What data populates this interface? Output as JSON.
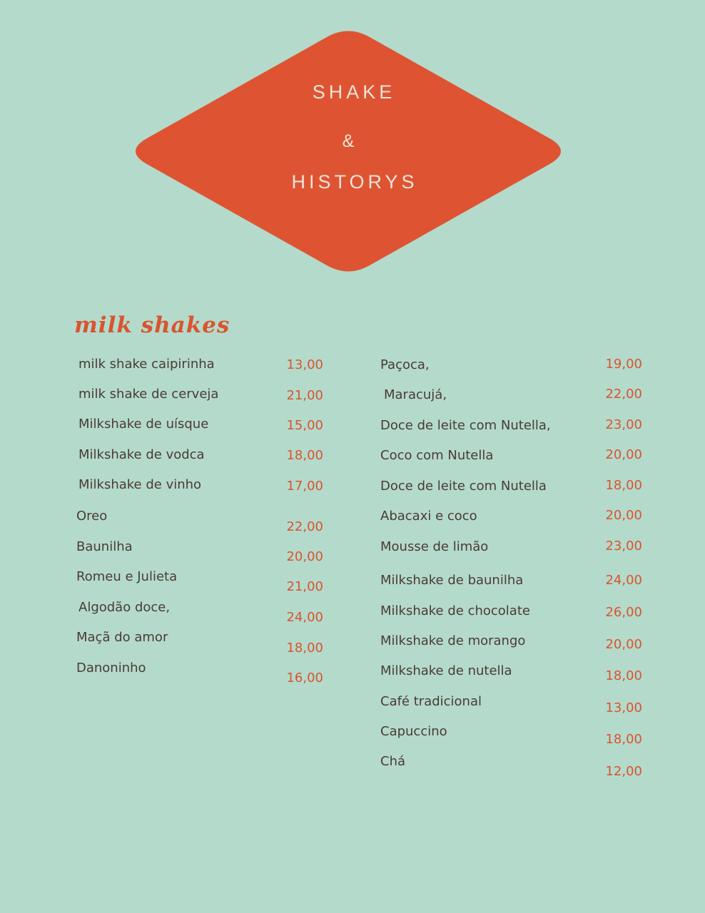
{
  "logo": {
    "line1": "SHAKE",
    "line2": "&",
    "line3": "HISTORYS",
    "fill_color": "#de5432"
  },
  "section": {
    "title": "milk shakes"
  },
  "left_items": [
    {
      "name": "milk shake caipirinha",
      "price": "13,00"
    },
    {
      "name": "milk shake de cerveja",
      "price": "21,00"
    },
    {
      "name": "Milkshake de uísque",
      "price": "15,00"
    },
    {
      "name": "Milkshake de vodca",
      "price": "18,00"
    },
    {
      "name": "Milkshake de vinho",
      "price": "17,00"
    },
    {
      "name": "Oreo",
      "price": "22,00"
    },
    {
      "name": "Baunilha",
      "price": "20,00"
    },
    {
      "name": "Romeu e Julieta",
      "price": "21,00"
    },
    {
      "name": "Algodão doce,",
      "price": "24,00"
    },
    {
      "name": "Maçã do amor",
      "price": "18,00"
    },
    {
      "name": "Danoninho",
      "price": "16,00"
    }
  ],
  "right_items": [
    {
      "name": "Paçoca,",
      "price": "19,00"
    },
    {
      "name": "Maracujá,",
      "price": "22,00"
    },
    {
      "name": "Doce de leite com Nutella,",
      "price": "23,00"
    },
    {
      "name": "Coco com Nutella",
      "price": "20,00"
    },
    {
      "name": "Doce de leite com Nutella",
      "price": "18,00"
    },
    {
      "name": "Abacaxi e coco",
      "price": "20,00"
    },
    {
      "name": "Mousse de limão",
      "price": "23,00"
    },
    {
      "name": "Milkshake de baunilha",
      "price": "24,00"
    },
    {
      "name": "Milkshake de chocolate",
      "price": "26,00"
    },
    {
      "name": "Milkshake de morango",
      "price": "20,00"
    },
    {
      "name": "Milkshake de nutella",
      "price": "18,00"
    },
    {
      "name": "Café tradicional",
      "price": "13,00"
    },
    {
      "name": "Capuccino",
      "price": "18,00"
    },
    {
      "name": "Chá",
      "price": "12,00"
    }
  ]
}
